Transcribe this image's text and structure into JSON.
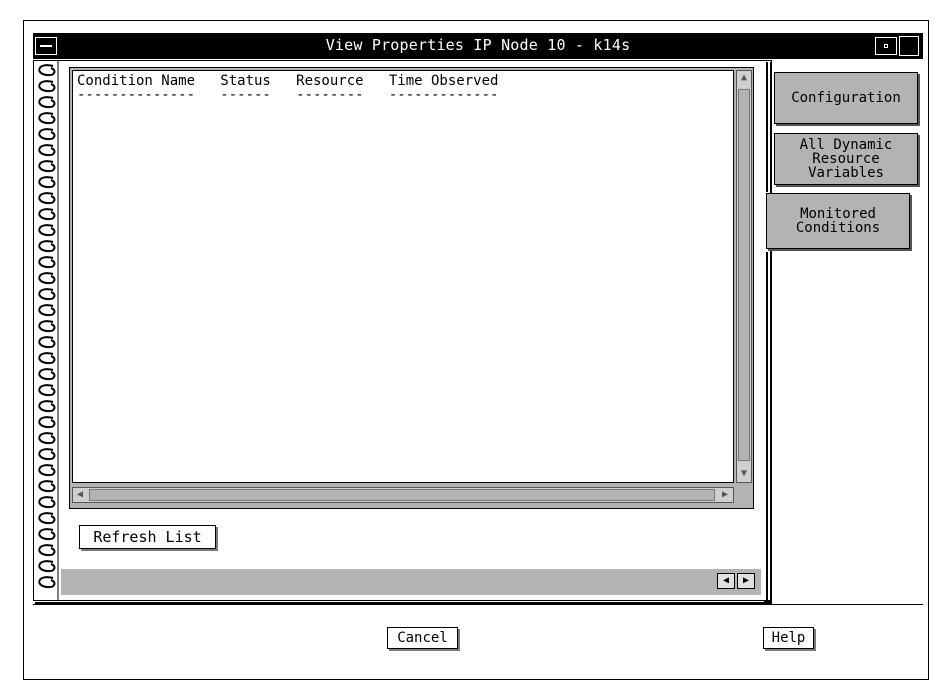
{
  "window": {
    "title": "View Properties IP Node 10 - k14s",
    "icons": {
      "menu": "window-menu-icon",
      "minimize": "minimize-icon",
      "maximize": "maximize-icon"
    }
  },
  "list": {
    "header": "Condition Name   Status   Resource   Time Observed",
    "dashes": "--------------   ------   --------   -------------",
    "rows": []
  },
  "buttons": {
    "refresh": "Refresh List",
    "cancel": "Cancel",
    "help": "Help"
  },
  "tabs": [
    {
      "label": "Configuration"
    },
    {
      "label": "All Dynamic\nResource\nVariables"
    },
    {
      "label": "Monitored\nConditions",
      "selected": true
    }
  ],
  "scroll": {
    "up": "▲",
    "down": "▼",
    "left": "◀",
    "right": "▶"
  },
  "pager": {
    "prev": "◀",
    "next": "▶"
  },
  "colors": {
    "panel": "#b3b3b3",
    "titlebar": "#000000"
  }
}
